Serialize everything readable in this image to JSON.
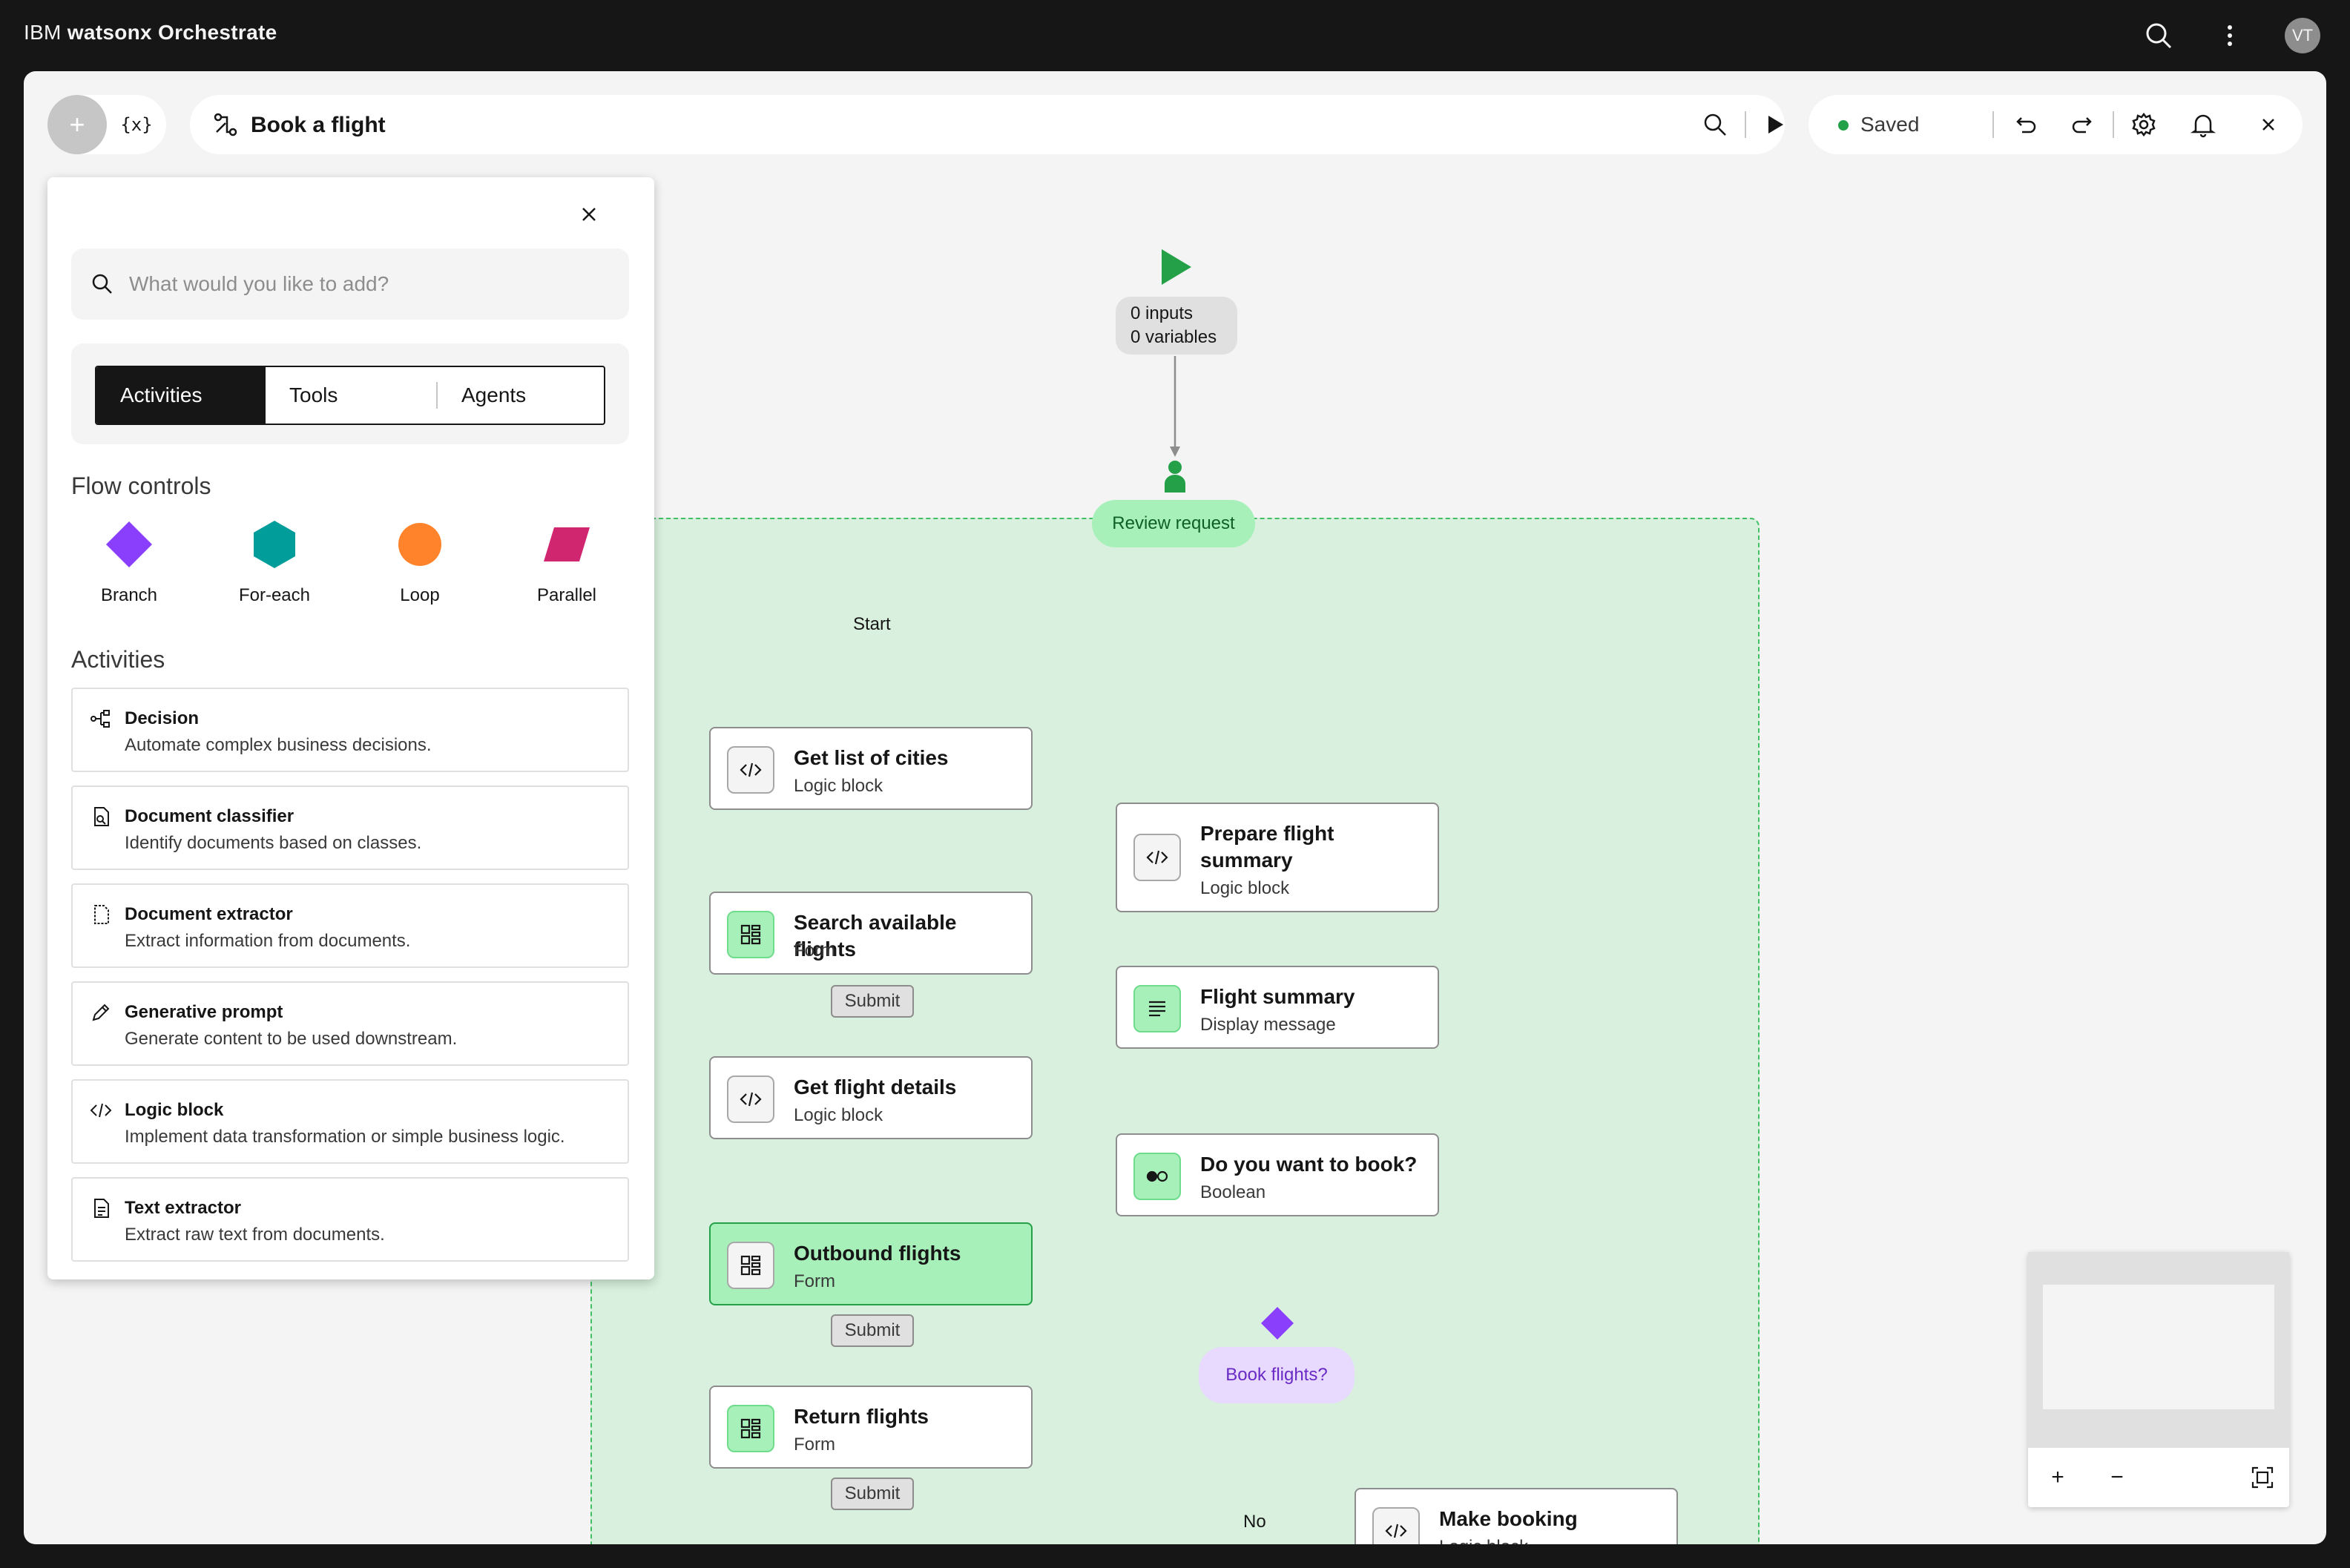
{
  "app": {
    "brand_prefix": "IBM",
    "brand_name": "watsonx Orchestrate",
    "avatar_initials": "VT"
  },
  "toolbar": {
    "add_label": "+",
    "variables_label": "{x}",
    "flow_title": "Book a flight",
    "status": "Saved",
    "status_color": "#24a148"
  },
  "panel": {
    "search_placeholder": "What would you like to add?",
    "tabs": [
      {
        "label": "Activities",
        "active": true
      },
      {
        "label": "Tools"
      },
      {
        "label": "Agents"
      }
    ],
    "flow_controls_title": "Flow controls",
    "flow_controls": [
      {
        "label": "Branch",
        "shape": "diamond",
        "color": "#8a3ffc"
      },
      {
        "label": "For-each",
        "shape": "hexagon",
        "color": "#009d9a"
      },
      {
        "label": "Loop",
        "shape": "circle",
        "color": "#ff832b"
      },
      {
        "label": "Parallel",
        "shape": "parallelogram",
        "color": "#d02670"
      }
    ],
    "activities_title": "Activities",
    "activities": [
      {
        "title": "Decision",
        "desc": "Automate complex business decisions.",
        "icon": "decision-icon"
      },
      {
        "title": "Document classifier",
        "desc": "Identify documents based on classes.",
        "icon": "document-classifier-icon"
      },
      {
        "title": "Document extractor",
        "desc": "Extract information from documents.",
        "icon": "document-extractor-icon"
      },
      {
        "title": "Generative prompt",
        "desc": "Generate content to be used downstream.",
        "icon": "pen-icon"
      },
      {
        "title": "Logic block",
        "desc": "Implement data transformation or simple business logic.",
        "icon": "code-icon"
      },
      {
        "title": "Text extractor",
        "desc": "Extract raw text from documents.",
        "icon": "text-extractor-icon"
      }
    ]
  },
  "canvas": {
    "start_io": {
      "inputs": "0 inputs",
      "variables": "0 variables"
    },
    "review_label": "Review request",
    "start_label": "Start",
    "nodes": [
      {
        "title": "Get list of cities",
        "sub": "Logic block"
      },
      {
        "title": "Search available flights",
        "sub": "Form"
      },
      {
        "title": "Get flight details",
        "sub": "Logic block"
      },
      {
        "title": "Outbound flights",
        "sub": "Form"
      },
      {
        "title": "Return flights",
        "sub": "Form"
      },
      {
        "title": "Prepare flight summary",
        "sub": "Logic block"
      },
      {
        "title": "Flight summary",
        "sub": "Display message"
      },
      {
        "title": "Do you want to book?",
        "sub": "Boolean"
      },
      {
        "title": "Make booking",
        "sub": "Logic block"
      }
    ],
    "submit_label": "Submit",
    "branch_label": "Book flights?",
    "no_label": "No"
  },
  "minimap": {
    "zoom_in": "+",
    "zoom_out": "−"
  }
}
